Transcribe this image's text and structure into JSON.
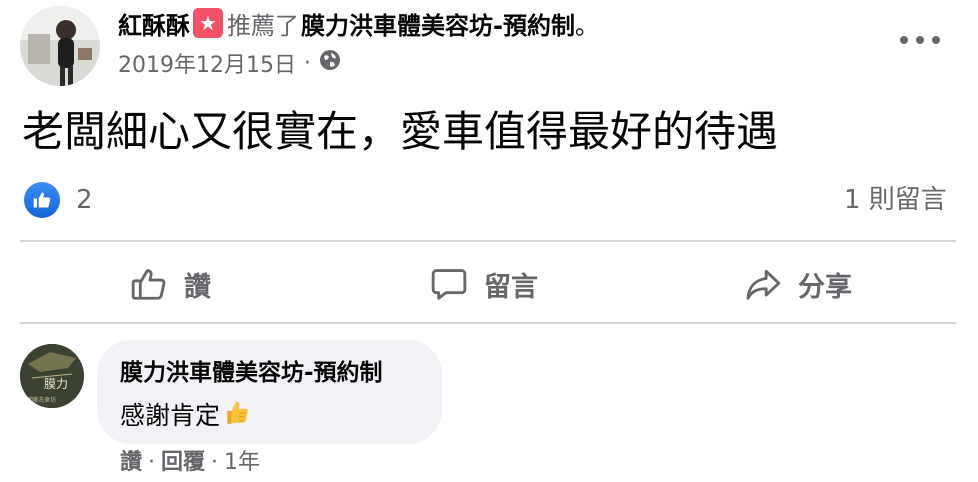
{
  "post": {
    "author": "紅酥酥",
    "recommend_badge_icon": "recommend-star-icon",
    "verb": "推薦了",
    "page_name": "膜力洪車體美容坊-預約制",
    "period": "。",
    "date": "2019年12月15日",
    "separator": "·",
    "privacy_icon": "globe-icon",
    "more_icon": "more-horizontal-icon",
    "text": "老闆細心又很實在，愛車值得最好的待遇"
  },
  "reactions": {
    "like_icon": "thumbs-up-icon",
    "count": "2",
    "comments_count_text": "1 則留言"
  },
  "actions": {
    "like_label": "讚",
    "comment_label": "留言",
    "share_label": "分享"
  },
  "comment": {
    "author": "膜力洪車體美容坊-預約制",
    "avatar_text": "膜力",
    "text": "感謝肯定",
    "emoji": "👍",
    "like_label": "讚",
    "separator": "·",
    "reply_label": "回覆",
    "time": "1年"
  },
  "colors": {
    "accent_blue": "#1877f2",
    "secondary_text": "#65676b",
    "recommend_red": "#f25268",
    "divider": "#d4d6da",
    "bubble_bg": "#f0f2f5"
  }
}
